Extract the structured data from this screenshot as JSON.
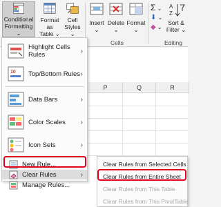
{
  "ribbon": {
    "conditional_formatting": {
      "line1": "Conditional",
      "line2": "Formatting"
    },
    "format_as_table": {
      "line1": "Format as",
      "line2": "Table"
    },
    "cell_styles": {
      "line1": "Cell",
      "line2": "Styles"
    },
    "insert": "Insert",
    "delete": "Delete",
    "format": "Format",
    "sort_filter": {
      "line1": "Sort &",
      "line2": "Filter"
    },
    "sigma": "Σ",
    "cells_label": "Cells",
    "editing_label": "Editing"
  },
  "columns": [
    "P",
    "Q",
    "R"
  ],
  "menu": {
    "items": [
      {
        "label": "Highlight Cells Rules",
        "icon": "highlight-cells-icon"
      },
      {
        "label": "Top/Bottom Rules",
        "icon": "top-bottom-icon"
      },
      {
        "label": "Data Bars",
        "icon": "data-bars-icon"
      },
      {
        "label": "Color Scales",
        "icon": "color-scales-icon"
      },
      {
        "label": "Icon Sets",
        "icon": "icon-sets-icon"
      },
      {
        "label": "New Rule...",
        "icon": "new-rule-icon"
      },
      {
        "label": "Clear Rules",
        "icon": "clear-rules-icon"
      },
      {
        "label": "Manage Rules...",
        "icon": "manage-rules-icon"
      }
    ]
  },
  "submenu": {
    "items": [
      {
        "label": "Clear Rules from Selected Cells",
        "enabled": true
      },
      {
        "label": "Clear Rules from Entire Sheet",
        "enabled": true
      },
      {
        "label": "Clear Rules from This Table",
        "enabled": false
      },
      {
        "label": "Clear Rules from This PivotTable",
        "enabled": false
      }
    ]
  },
  "colors": {
    "highlight_box": "#e0001b",
    "accent_green": "#217346"
  }
}
